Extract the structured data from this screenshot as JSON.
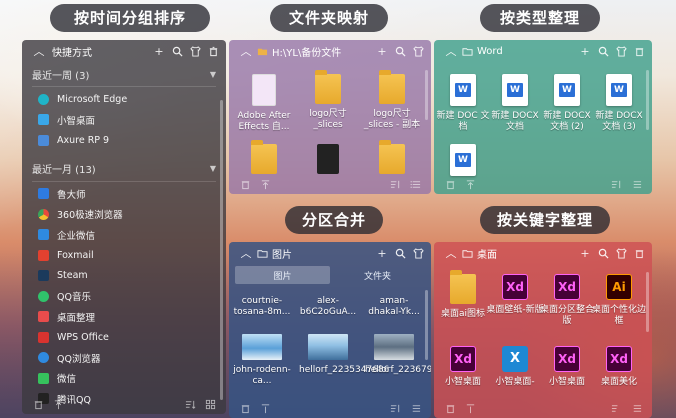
{
  "captions": {
    "sort_by_time": "按时间分组排序",
    "folder_map": "文件夹映射",
    "sort_by_type": "按类型整理",
    "partition_merge": "分区合并",
    "sort_by_keyword": "按关键字整理"
  },
  "shortcuts": {
    "title": "快捷方式",
    "group1": "最近一周 (3)",
    "group1_items": [
      "Microsoft Edge",
      "小智桌面",
      "Axure RP 9"
    ],
    "group2": "最近一月 (13)",
    "group2_items": [
      "鲁大师",
      "360极速浏览器",
      "企业微信",
      "Foxmail",
      "Steam",
      "QQ音乐",
      "桌面整理",
      "WPS Office",
      "QQ浏览器",
      "微信",
      "腾讯QQ"
    ]
  },
  "folder": {
    "title": "H:\\YL\\备份文件",
    "items": [
      "Adobe After Effects 自...",
      "logo尺寸_slices",
      "logo尺寸_slices - 副本",
      "",
      "",
      ""
    ]
  },
  "word": {
    "title": "Word",
    "items": [
      "新建 DOC 文档",
      "新建 DOCX 文档",
      "新建 DOCX 文档 (2)",
      "新建 DOCX 文档 (3)",
      ""
    ]
  },
  "pictures": {
    "title": "图片",
    "tabs": [
      "图片",
      "文件夹"
    ],
    "items": [
      "courtnie-tosana-8m...",
      "alex-b6C2oGuA...",
      "aman-dhakal-Yk...",
      "john-rodenn-ca...",
      "hellorf_2235347686",
      "hellorf_2236799331"
    ]
  },
  "desktop": {
    "title": "桌面",
    "items": [
      "桌面ai图标",
      "桌面壁纸-新版",
      "桌面分区整合版",
      "桌面个性化边框",
      "小智桌面",
      "小智桌面-",
      "小智桌面",
      "桌面美化"
    ]
  }
}
